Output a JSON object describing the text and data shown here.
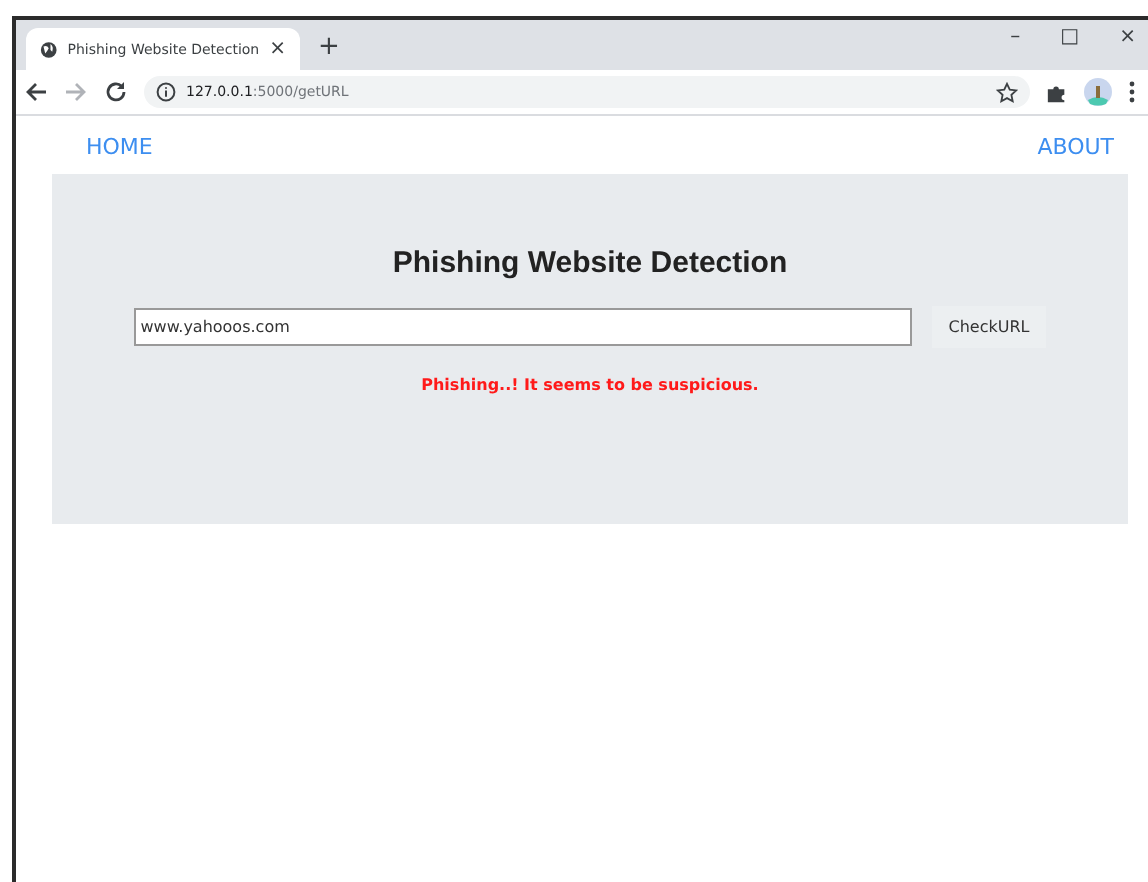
{
  "browser": {
    "tab": {
      "title": "Phishing Website Detection",
      "close": "×",
      "selected": true
    },
    "new_tab": "+",
    "window_controls": [
      "–",
      "□",
      "×"
    ],
    "address": {
      "host": "127.0.0.1",
      "path": ":5000/getURL"
    }
  },
  "nav": [
    {
      "label": "HOME"
    },
    {
      "label": "ABOUT"
    }
  ],
  "main": {
    "heading": "Phishing Website Detection",
    "url_field": {
      "value": "www.yahooos.com"
    },
    "button": "CheckURL",
    "result": {
      "kind": "phishing",
      "text": "Phishing..! It seems to be suspicious."
    }
  }
}
